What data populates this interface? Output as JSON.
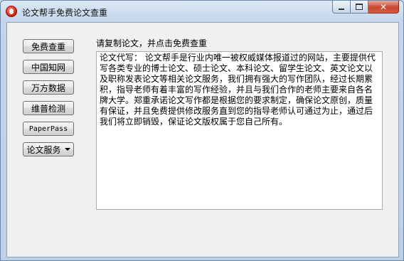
{
  "window": {
    "title": "论文帮手免费论文查重"
  },
  "sidebar": {
    "buttons": [
      {
        "label": "免费查重"
      },
      {
        "label": "中国知网"
      },
      {
        "label": "万方数据"
      },
      {
        "label": "维普检测"
      },
      {
        "label": "PaperPass"
      },
      {
        "label": "论文服务"
      }
    ]
  },
  "main": {
    "prompt": "请复制论文，并点击免费查重",
    "textarea_value": "论文代写：  论文帮手是行业内唯一被权威媒体报道过的网站，主要提供代写各类专业的博士论文、硕士论文、本科论文、留学生论文、英文论文以及职称发表论文等相关论文服务，我们拥有强大的写作团队，经过长期累积，指导老师有着丰富的写作经验，并且与我们合作的老师主要来自各名牌大学。郑重承诺论文写作都是根据您的要求制定，确保论文原创，质量有保证，并且免费提供修改服务直到您的指导老师认可通过为止，通过后我们将立即销毁，保证论文版权属于您自己所有。"
  },
  "icons": {
    "app": "app-logo-icon",
    "minimize": "minimize-icon",
    "maximize": "maximize-icon",
    "close": "close-icon",
    "dropdown": "chevron-down-icon"
  },
  "colors": {
    "close_button": "#c9462f",
    "app_icon": "#c8180c"
  }
}
